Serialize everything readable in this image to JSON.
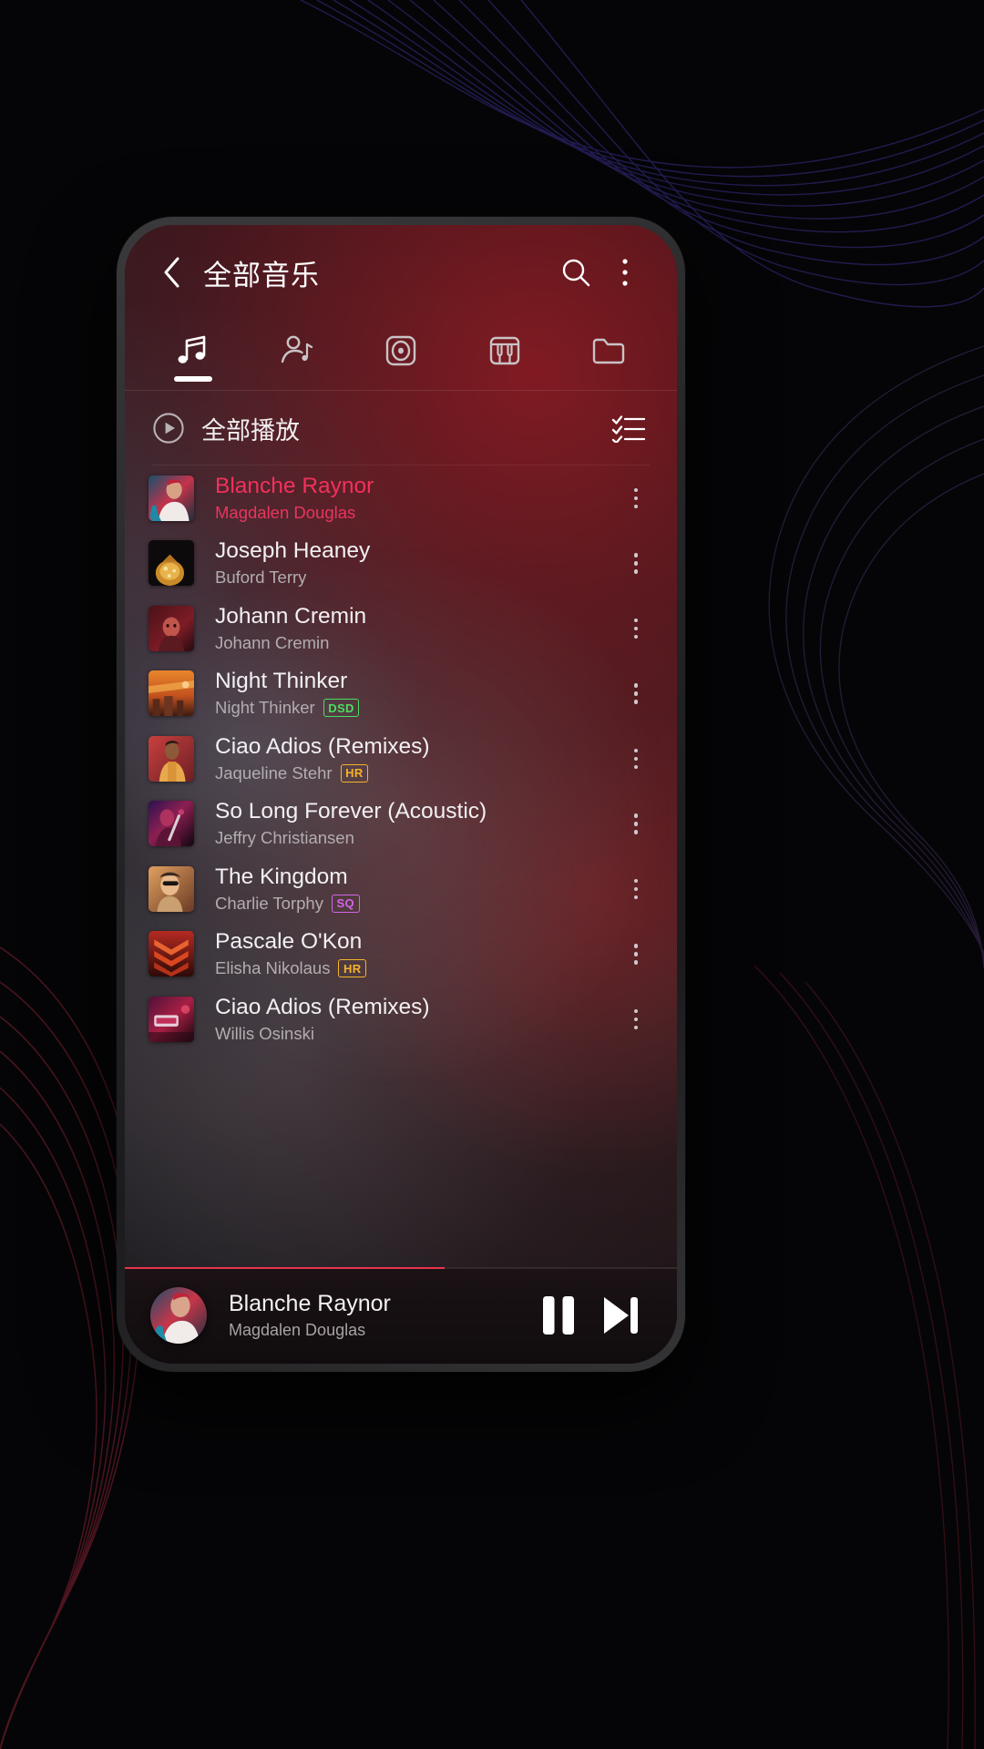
{
  "header": {
    "title": "全部音乐",
    "back_icon": "chevron-left-icon",
    "search_icon": "search-icon",
    "overflow_icon": "more-vertical-icon"
  },
  "tabs": [
    {
      "name": "songs",
      "icon": "music-note-icon",
      "active": true
    },
    {
      "name": "artists",
      "icon": "artist-icon",
      "active": false
    },
    {
      "name": "albums",
      "icon": "album-disc-icon",
      "active": false
    },
    {
      "name": "genres",
      "icon": "piano-keys-icon",
      "active": false
    },
    {
      "name": "folders",
      "icon": "folder-icon",
      "active": false
    }
  ],
  "play_all": {
    "label": "全部播放",
    "play_icon": "play-circle-icon",
    "multiselect_icon": "checklist-icon"
  },
  "songs": [
    {
      "title": "Blanche Raynor",
      "artist": "Magdalen Douglas",
      "badge": "",
      "active": true,
      "art": "a1"
    },
    {
      "title": "Joseph Heaney",
      "artist": "Buford Terry",
      "badge": "",
      "active": false,
      "art": "a2"
    },
    {
      "title": "Johann Cremin",
      "artist": "Johann Cremin",
      "badge": "",
      "active": false,
      "art": "a3"
    },
    {
      "title": "Night Thinker",
      "artist": "Night Thinker",
      "badge": "DSD",
      "active": false,
      "art": "a4"
    },
    {
      "title": "Ciao Adios (Remixes)",
      "artist": "Jaqueline Stehr",
      "badge": "HR",
      "active": false,
      "art": "a5"
    },
    {
      "title": "So Long Forever (Acoustic)",
      "artist": "Jeffry Christiansen",
      "badge": "",
      "active": false,
      "art": "a6"
    },
    {
      "title": "The Kingdom",
      "artist": "Charlie Torphy",
      "badge": "SQ",
      "active": false,
      "art": "a7"
    },
    {
      "title": "Pascale O'Kon",
      "artist": "Elisha Nikolaus",
      "badge": "HR",
      "active": false,
      "art": "a8"
    },
    {
      "title": "Ciao Adios (Remixes)",
      "artist": "Willis Osinski",
      "badge": "",
      "active": false,
      "art": "a9"
    }
  ],
  "now_playing": {
    "title": "Blanche Raynor",
    "artist": "Magdalen Douglas",
    "pause_icon": "pause-icon",
    "next_icon": "skip-next-icon",
    "progress_percent": 58
  },
  "colors": {
    "accent_pink": "#f1315c",
    "badge_dsd": "#4ade5e",
    "badge_hr": "#f4b32a",
    "badge_sq": "#d464e8",
    "progress": "#e8344f"
  }
}
